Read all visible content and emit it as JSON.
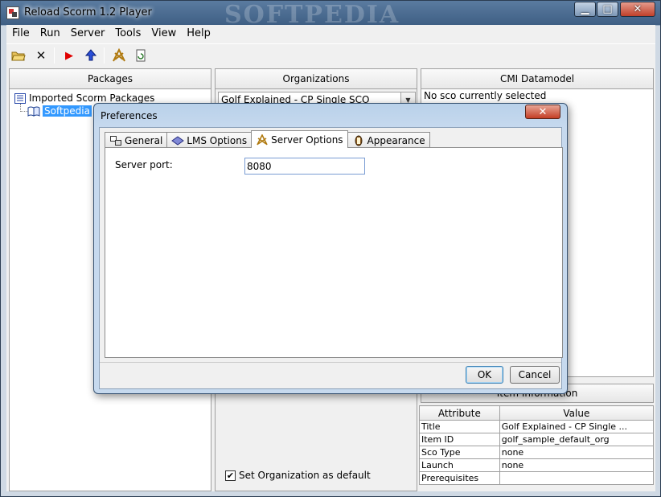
{
  "window": {
    "title": "Reload Scorm 1.2 Player",
    "watermark": "SOFTPEDIA",
    "controls": {
      "minimize": "▁",
      "maximize": "□",
      "close": "✕"
    }
  },
  "menu": [
    "File",
    "Run",
    "Server",
    "Tools",
    "View",
    "Help"
  ],
  "toolbar": {
    "icons": [
      "open-folder-icon",
      "delete-icon",
      "run-icon",
      "upload-icon",
      "server-icon",
      "refresh-icon"
    ],
    "glyphs": {
      "open": "📂",
      "delete": "✕",
      "run": "▶",
      "upload": "⬆",
      "server": "✱",
      "refresh": "↻"
    }
  },
  "packages": {
    "header": "Packages",
    "root": "Imported Scorm Packages",
    "child": "Softpedia"
  },
  "organizations": {
    "header": "Organizations",
    "selected": "Golf Explained - CP Single SCO",
    "default_checkbox_label": "Set Organization as default",
    "default_checked": true
  },
  "cmi": {
    "header": "CMI Datamodel",
    "status": "No sco currently selected"
  },
  "item_info": {
    "header": "Item Information",
    "columns": [
      "Attribute",
      "Value"
    ],
    "rows": [
      [
        "Title",
        "Golf Explained - CP Single ..."
      ],
      [
        "Item ID",
        "golf_sample_default_org"
      ],
      [
        "Sco Type",
        "none"
      ],
      [
        "Launch",
        "none"
      ],
      [
        "Prerequisites",
        ""
      ]
    ]
  },
  "dialog": {
    "title": "Preferences",
    "close": "✕",
    "tabs": [
      {
        "label": "General",
        "icon": "general-icon"
      },
      {
        "label": "LMS Options",
        "icon": "lms-icon"
      },
      {
        "label": "Server Options",
        "icon": "server-icon"
      },
      {
        "label": "Appearance",
        "icon": "appearance-icon"
      }
    ],
    "active_tab": "Server Options",
    "server_port_label": "Server port:",
    "server_port_value": "8080",
    "ok": "OK",
    "cancel": "Cancel"
  },
  "colors": {
    "selection": "#3399ff",
    "titlebar": "#4e6d8e",
    "dialog_frame": "#b9d1ea",
    "close_button": "#c43e25"
  }
}
